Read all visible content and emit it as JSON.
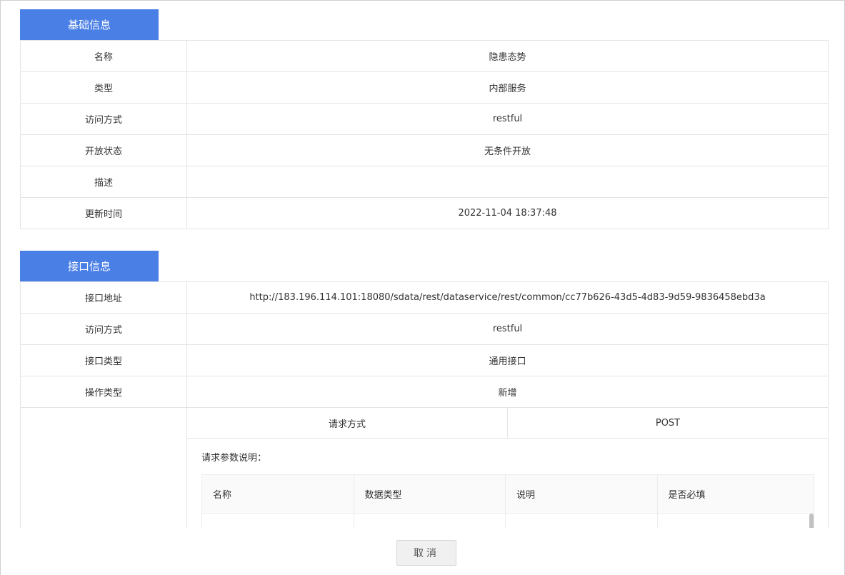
{
  "basic": {
    "tab_label": "基础信息",
    "rows": [
      {
        "label": "名称",
        "value": "隐患态势"
      },
      {
        "label": "类型",
        "value": "内部服务"
      },
      {
        "label": "访问方式",
        "value": "restful"
      },
      {
        "label": "开放状态",
        "value": "无条件开放"
      },
      {
        "label": "描述",
        "value": ""
      },
      {
        "label": "更新时间",
        "value": "2022-11-04 18:37:48"
      }
    ]
  },
  "interface": {
    "tab_label": "接口信息",
    "rows": [
      {
        "label": "接口地址",
        "value": "http://183.196.114.101:18080/sdata/rest/dataservice/rest/common/cc77b626-43d5-4d83-9d59-9836458ebd3a"
      },
      {
        "label": "访问方式",
        "value": "restful"
      },
      {
        "label": "接口类型",
        "value": "通用接口"
      },
      {
        "label": "操作类型",
        "value": "新增"
      }
    ],
    "request": {
      "method_label": "请求方式",
      "method_value": "POST",
      "params_title": "请求参数说明：",
      "param_headers": [
        "名称",
        "数据类型",
        "说明",
        "是否必填"
      ]
    }
  },
  "footer": {
    "cancel_label": "取消"
  }
}
